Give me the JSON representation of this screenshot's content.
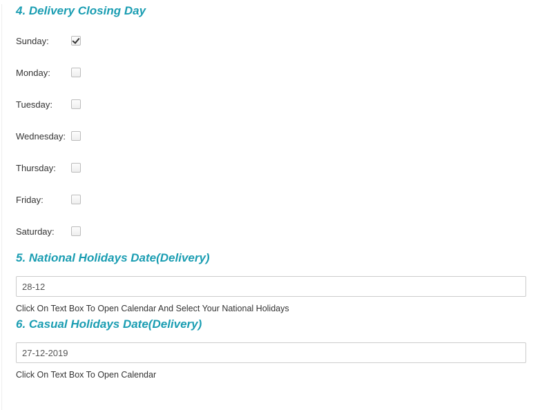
{
  "sections": {
    "closing": {
      "title": "4. Delivery Closing Day",
      "days": [
        {
          "label": "Sunday:",
          "checked": true
        },
        {
          "label": "Monday:",
          "checked": false
        },
        {
          "label": "Tuesday:",
          "checked": false
        },
        {
          "label": "Wednesday:",
          "checked": false
        },
        {
          "label": "Thursday:",
          "checked": false
        },
        {
          "label": "Friday:",
          "checked": false
        },
        {
          "label": "Saturday:",
          "checked": false
        }
      ]
    },
    "national": {
      "title": "5. National Holidays Date(Delivery)",
      "value": "28-12",
      "help": "Click On Text Box To Open Calendar And Select Your National Holidays"
    },
    "casual": {
      "title": "6. Casual Holidays Date(Delivery)",
      "value": "27-12-2019",
      "help": "Click On Text Box To Open Calendar"
    }
  }
}
